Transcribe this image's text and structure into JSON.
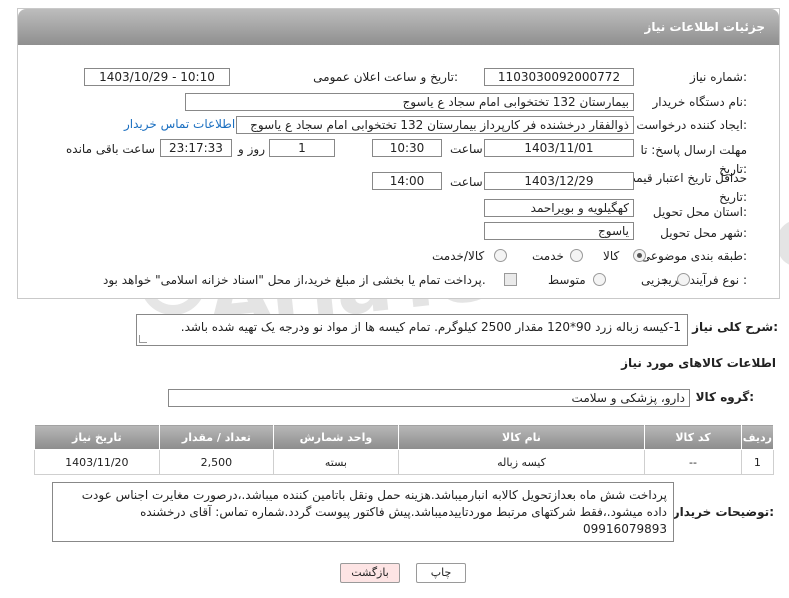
{
  "header": {
    "title": "جزئیات اطلاعات نیاز"
  },
  "fields": {
    "need_number": {
      "label": "شماره نیاز:",
      "value": "1103030092000772"
    },
    "announce_datetime": {
      "label": "تاریخ و ساعت اعلان عمومی:",
      "value": "1403/10/29 - 10:10"
    },
    "buyer_org": {
      "label": "نام دستگاه خریدار:",
      "value": "بیمارستان 132 تختخوابی امام سجاد  ع  یاسوج"
    },
    "requester": {
      "label": "ایجاد کننده درخواست:",
      "value": "ذوالفقار درخشنده فر کارپرداز بیمارستان 132 تختخوابی امام سجاد  ع  یاسوج",
      "contact_link": "اطلاعات تماس خریدار"
    },
    "reply_deadline": {
      "label": "مهلت ارسال پاسخ: تا تاریخ:",
      "date": "1403/11/01",
      "time_label": "ساعت",
      "time": "10:30",
      "days": "1",
      "days_label": "روز و",
      "remaining": "23:17:33",
      "remaining_label": "ساعت باقی مانده"
    },
    "price_validity": {
      "label": "حداقل تاریخ اعتبار قیمت: تا تاریخ:",
      "date": "1403/12/29",
      "time_label": "ساعت",
      "time": "14:00"
    },
    "province": {
      "label": "استان محل تحویل:",
      "value": "کهگیلویه و بویراحمد"
    },
    "city": {
      "label": "شهر محل تحویل:",
      "value": "یاسوج"
    },
    "category": {
      "label": "طبقه بندی موضوعی:",
      "options": [
        "کالا",
        "خدمت",
        "کالا/خدمت"
      ],
      "selected": "کالا"
    },
    "purchase_type": {
      "label": "نوع فرآیند خرید :",
      "options": [
        "جزیی",
        "متوسط"
      ],
      "note": "پرداخت تمام یا بخشی از مبلغ خرید،از محل \"اسناد خزانه اسلامی\" خواهد بود."
    }
  },
  "description": {
    "label": "شرح کلی نیاز:",
    "value": "1-کیسه زباله زرد 90*120 مقدار 2500 کیلوگرم. تمام کیسه ها از مواد نو ودرجه یک تهیه شده باشد."
  },
  "goods_section": {
    "title": "اطلاعات کالاهای مورد نیاز"
  },
  "goods_group": {
    "label": "گروه کالا:",
    "value": "دارو، پزشکی و سلامت"
  },
  "table": {
    "headers": [
      "ردیف",
      "کد کالا",
      "نام کالا",
      "واحد شمارش",
      "تعداد / مقدار",
      "تاریخ نیاز"
    ],
    "rows": [
      {
        "row": "1",
        "code": "--",
        "name": "کیسه زباله",
        "unit": "بسته",
        "qty": "2,500",
        "date": "1403/11/20"
      }
    ]
  },
  "buyer_notes": {
    "label": "توضیحات خریدار:",
    "value": "پرداخت شش ماه بعدازتحویل کالابه انبارمیباشد.هزینه حمل ونقل باتامین کننده میباشد.،درصورت مغایرت اجناس عودت داده میشود.،فقط شرکتهای مرتبط موردتاییدمیباشد.پیش فاکتور پیوست گردد.شماره تماس: آقای درخشنده 09916079893"
  },
  "buttons": {
    "print": "چاپ",
    "back": "بازگشت"
  },
  "watermark": "AriaTender.neT",
  "colors": {
    "header_bg": "#9e9e9e",
    "link": "#1b6fc0",
    "back_button_bg": "#fde4e4",
    "print_button_bg": "#ffffff"
  }
}
